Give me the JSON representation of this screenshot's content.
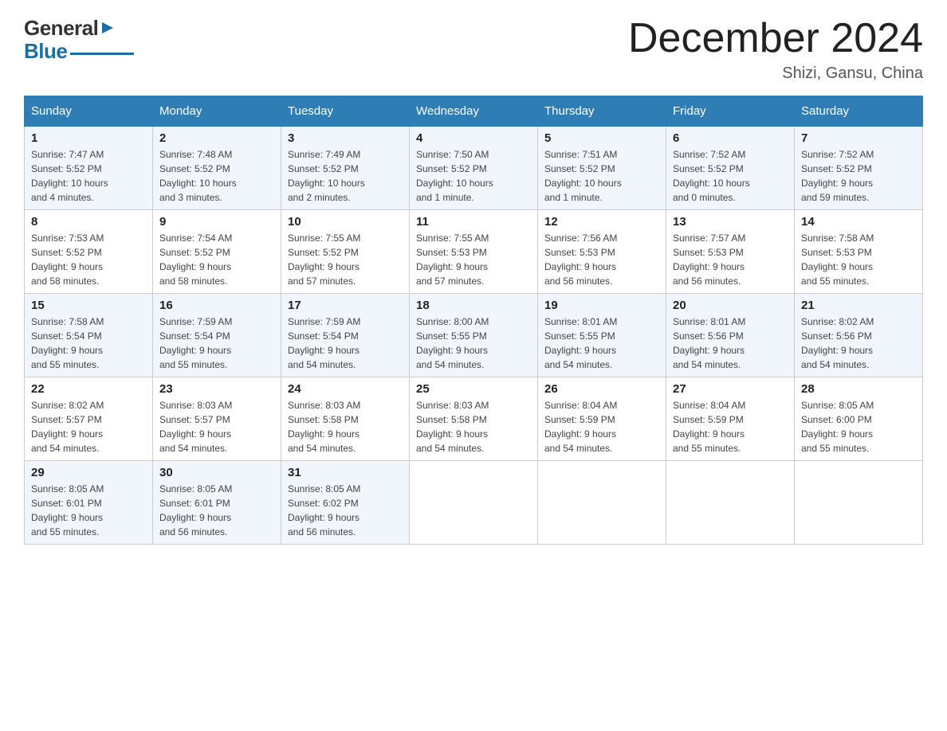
{
  "logo": {
    "general": "General",
    "blue": "Blue"
  },
  "header": {
    "title": "December 2024",
    "subtitle": "Shizi, Gansu, China"
  },
  "weekdays": [
    "Sunday",
    "Monday",
    "Tuesday",
    "Wednesday",
    "Thursday",
    "Friday",
    "Saturday"
  ],
  "weeks": [
    [
      {
        "day": "1",
        "sunrise": "7:47 AM",
        "sunset": "5:52 PM",
        "daylight": "10 hours and 4 minutes."
      },
      {
        "day": "2",
        "sunrise": "7:48 AM",
        "sunset": "5:52 PM",
        "daylight": "10 hours and 3 minutes."
      },
      {
        "day": "3",
        "sunrise": "7:49 AM",
        "sunset": "5:52 PM",
        "daylight": "10 hours and 2 minutes."
      },
      {
        "day": "4",
        "sunrise": "7:50 AM",
        "sunset": "5:52 PM",
        "daylight": "10 hours and 1 minute."
      },
      {
        "day": "5",
        "sunrise": "7:51 AM",
        "sunset": "5:52 PM",
        "daylight": "10 hours and 1 minute."
      },
      {
        "day": "6",
        "sunrise": "7:52 AM",
        "sunset": "5:52 PM",
        "daylight": "10 hours and 0 minutes."
      },
      {
        "day": "7",
        "sunrise": "7:52 AM",
        "sunset": "5:52 PM",
        "daylight": "9 hours and 59 minutes."
      }
    ],
    [
      {
        "day": "8",
        "sunrise": "7:53 AM",
        "sunset": "5:52 PM",
        "daylight": "9 hours and 58 minutes."
      },
      {
        "day": "9",
        "sunrise": "7:54 AM",
        "sunset": "5:52 PM",
        "daylight": "9 hours and 58 minutes."
      },
      {
        "day": "10",
        "sunrise": "7:55 AM",
        "sunset": "5:52 PM",
        "daylight": "9 hours and 57 minutes."
      },
      {
        "day": "11",
        "sunrise": "7:55 AM",
        "sunset": "5:53 PM",
        "daylight": "9 hours and 57 minutes."
      },
      {
        "day": "12",
        "sunrise": "7:56 AM",
        "sunset": "5:53 PM",
        "daylight": "9 hours and 56 minutes."
      },
      {
        "day": "13",
        "sunrise": "7:57 AM",
        "sunset": "5:53 PM",
        "daylight": "9 hours and 56 minutes."
      },
      {
        "day": "14",
        "sunrise": "7:58 AM",
        "sunset": "5:53 PM",
        "daylight": "9 hours and 55 minutes."
      }
    ],
    [
      {
        "day": "15",
        "sunrise": "7:58 AM",
        "sunset": "5:54 PM",
        "daylight": "9 hours and 55 minutes."
      },
      {
        "day": "16",
        "sunrise": "7:59 AM",
        "sunset": "5:54 PM",
        "daylight": "9 hours and 55 minutes."
      },
      {
        "day": "17",
        "sunrise": "7:59 AM",
        "sunset": "5:54 PM",
        "daylight": "9 hours and 54 minutes."
      },
      {
        "day": "18",
        "sunrise": "8:00 AM",
        "sunset": "5:55 PM",
        "daylight": "9 hours and 54 minutes."
      },
      {
        "day": "19",
        "sunrise": "8:01 AM",
        "sunset": "5:55 PM",
        "daylight": "9 hours and 54 minutes."
      },
      {
        "day": "20",
        "sunrise": "8:01 AM",
        "sunset": "5:56 PM",
        "daylight": "9 hours and 54 minutes."
      },
      {
        "day": "21",
        "sunrise": "8:02 AM",
        "sunset": "5:56 PM",
        "daylight": "9 hours and 54 minutes."
      }
    ],
    [
      {
        "day": "22",
        "sunrise": "8:02 AM",
        "sunset": "5:57 PM",
        "daylight": "9 hours and 54 minutes."
      },
      {
        "day": "23",
        "sunrise": "8:03 AM",
        "sunset": "5:57 PM",
        "daylight": "9 hours and 54 minutes."
      },
      {
        "day": "24",
        "sunrise": "8:03 AM",
        "sunset": "5:58 PM",
        "daylight": "9 hours and 54 minutes."
      },
      {
        "day": "25",
        "sunrise": "8:03 AM",
        "sunset": "5:58 PM",
        "daylight": "9 hours and 54 minutes."
      },
      {
        "day": "26",
        "sunrise": "8:04 AM",
        "sunset": "5:59 PM",
        "daylight": "9 hours and 54 minutes."
      },
      {
        "day": "27",
        "sunrise": "8:04 AM",
        "sunset": "5:59 PM",
        "daylight": "9 hours and 55 minutes."
      },
      {
        "day": "28",
        "sunrise": "8:05 AM",
        "sunset": "6:00 PM",
        "daylight": "9 hours and 55 minutes."
      }
    ],
    [
      {
        "day": "29",
        "sunrise": "8:05 AM",
        "sunset": "6:01 PM",
        "daylight": "9 hours and 55 minutes."
      },
      {
        "day": "30",
        "sunrise": "8:05 AM",
        "sunset": "6:01 PM",
        "daylight": "9 hours and 56 minutes."
      },
      {
        "day": "31",
        "sunrise": "8:05 AM",
        "sunset": "6:02 PM",
        "daylight": "9 hours and 56 minutes."
      },
      null,
      null,
      null,
      null
    ]
  ],
  "labels": {
    "sunrise": "Sunrise:",
    "sunset": "Sunset:",
    "daylight": "Daylight:"
  }
}
